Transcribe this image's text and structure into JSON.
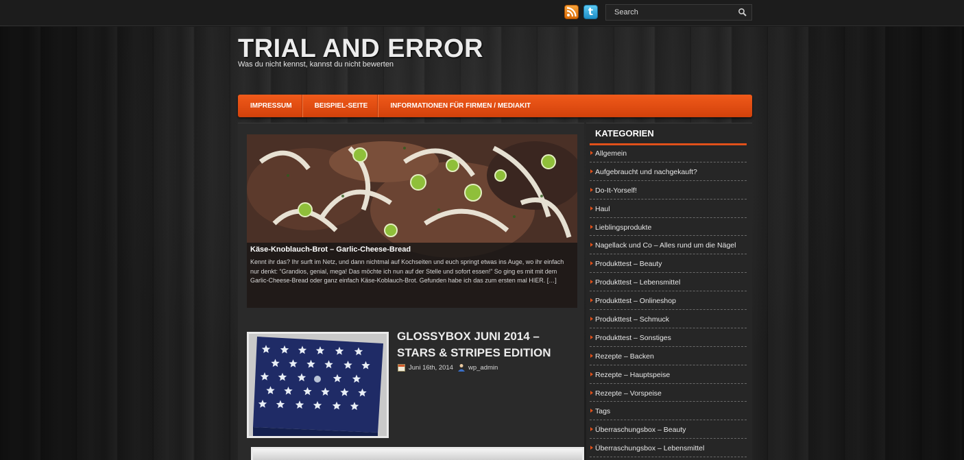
{
  "topbar": {
    "rss_icon": "rss-icon",
    "twitter_icon": "twitter-icon",
    "twitter_glyph": "t",
    "search_placeholder": "Search"
  },
  "header": {
    "title": "TRIAL AND ERROR",
    "tagline": "Was du nicht kennst, kannst du nicht bewerten"
  },
  "nav": {
    "items": [
      {
        "label": "IMPRESSUM"
      },
      {
        "label": "BEISPIEL-SEITE"
      },
      {
        "label": "INFORMATIONEN FÜR FIRMEN / MEDIAKIT"
      }
    ]
  },
  "featured": {
    "title": "Käse-Knoblauch-Brot – Garlic-Cheese-Bread",
    "excerpt": "Kennt ihr das? Ihr surft im Netz, und dann nichtmal auf Kochseiten und euch springt etwas ins Auge, wo ihr einfach nur denkt: “Grandios, genial, mega! Das möchte ich nun auf der Stelle und sofort essen!” So ging es mit mit dem Garlic-Cheese-Bread oder ganz einfach Käse-Koblauch-Brot. Gefunden habe ich das zum ersten mal HIER. […]"
  },
  "post": {
    "title": "GLOSSYBOX JUNI 2014 – STARS & STRIPES EDITION",
    "date": "Juni 16th, 2014",
    "author": "wp_admin"
  },
  "sidebar": {
    "widget_title": "KATEGORIEN",
    "categories": [
      "Allgemein",
      "Aufgebraucht und nachgekauft?",
      "Do-It-Yorself!",
      "Haul",
      "Lieblingsprodukte",
      "Nagellack und Co – Alles rund um die Nägel",
      "Produkttest – Beauty",
      "Produkttest – Lebensmittel",
      "Produkttest – Onlineshop",
      "Produkttest – Schmuck",
      "Produkttest – Sonstiges",
      "Rezepte – Backen",
      "Rezepte – Hauptspeise",
      "Rezepte – Vorspeise",
      "Tags",
      "Überraschungsbox – Beauty",
      "Überraschungsbox – Lebensmittel"
    ]
  },
  "colors": {
    "accent": "#e0501a",
    "background": "#1a1a1a"
  }
}
